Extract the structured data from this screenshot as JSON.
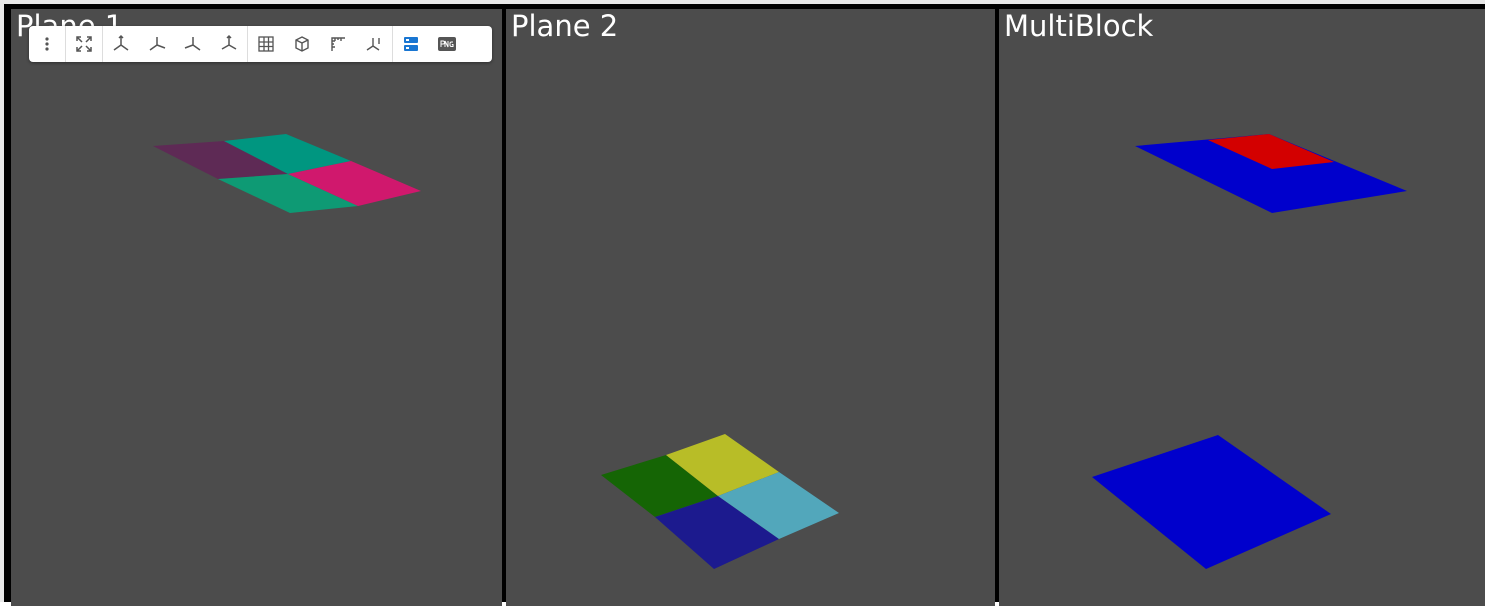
{
  "viewports": [
    {
      "title": "Plane 1"
    },
    {
      "title": "Plane 2"
    },
    {
      "title": "MultiBlock"
    }
  ],
  "toolbar": {
    "buttons": [
      {
        "icon": "more-vertical-icon"
      },
      {
        "icon": "fullscreen-icon"
      },
      {
        "icon": "axis-view-icon"
      },
      {
        "icon": "axis-view-icon"
      },
      {
        "icon": "axis-view-icon"
      },
      {
        "icon": "axis-view-icon"
      },
      {
        "icon": "grid-toggle-icon"
      },
      {
        "icon": "bounding-box-icon"
      },
      {
        "icon": "ruler-icon"
      },
      {
        "icon": "axes-info-icon"
      },
      {
        "icon": "panel-toggle-icon"
      },
      {
        "icon": "png-export-icon"
      }
    ]
  },
  "colors": {
    "background": "#4c4c4c",
    "plane1": [
      "#5e2a55",
      "#009680",
      "#0e9a74",
      "#d0186d"
    ],
    "plane2": [
      "#156505",
      "#b8bd27",
      "#1c1a8e",
      "#52a7bb"
    ],
    "multiblock_red": "#d30000",
    "multiblock_blue": "#0000cc",
    "toolbar_accent": "#1976d2"
  }
}
